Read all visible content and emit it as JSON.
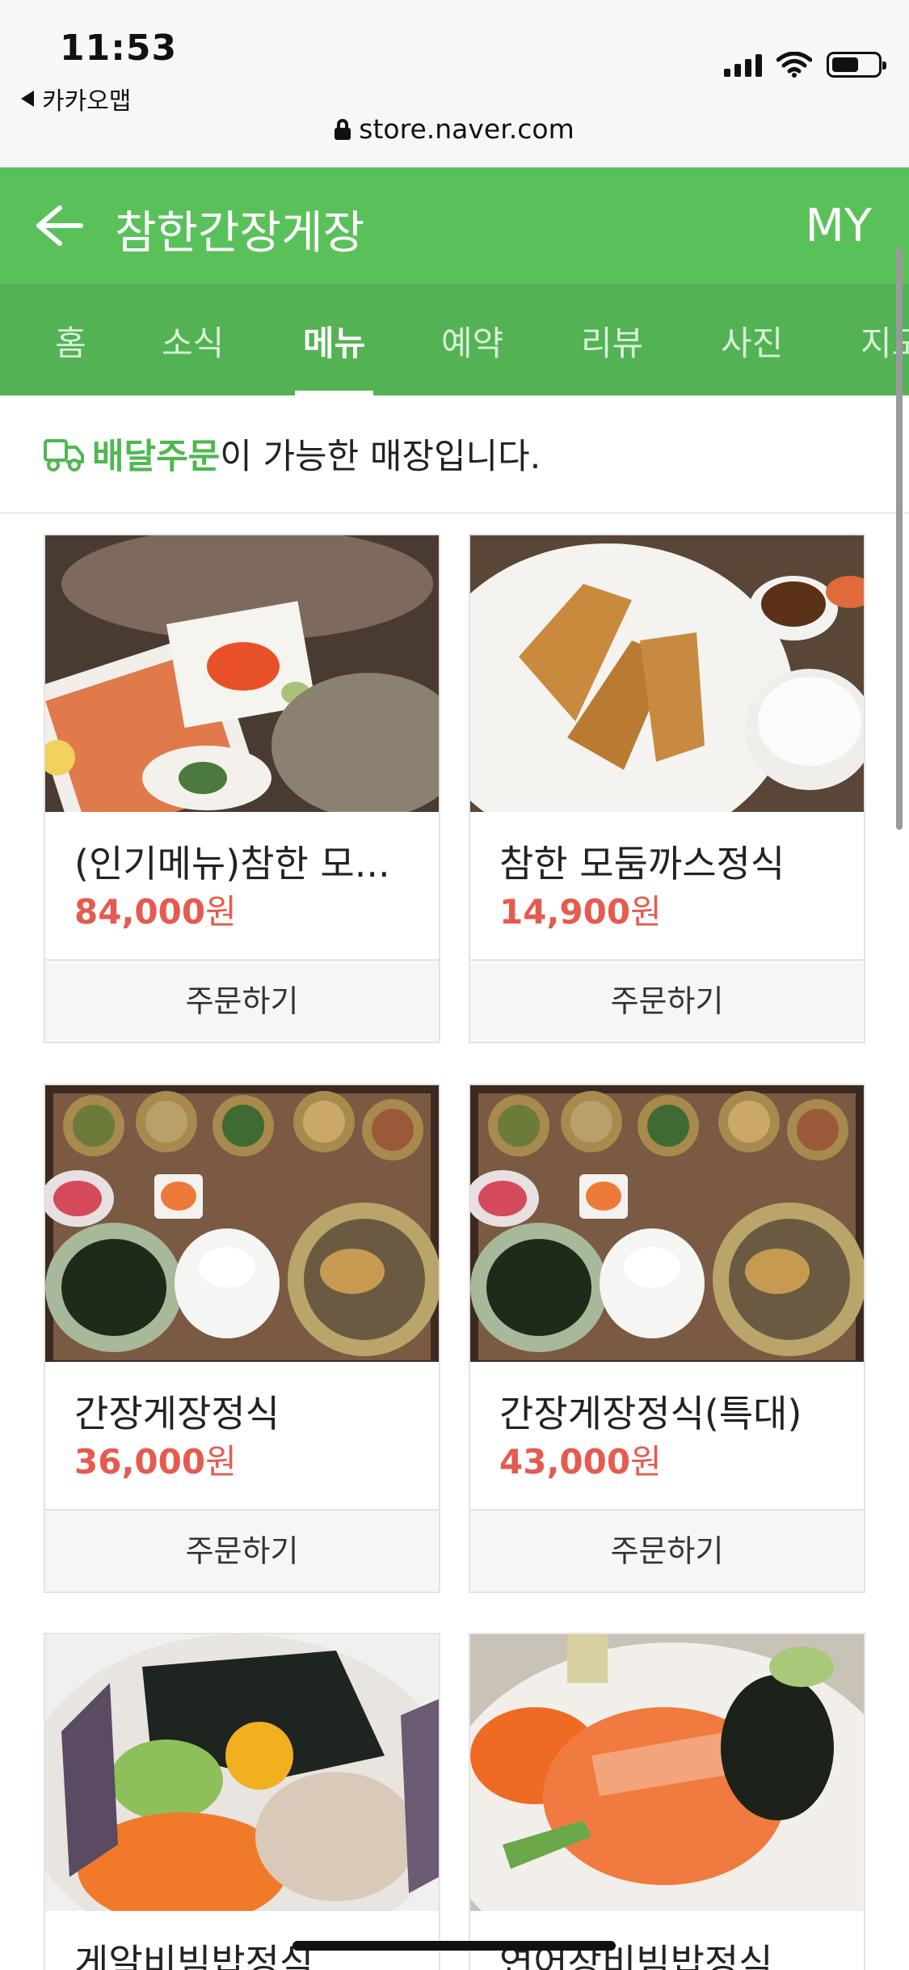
{
  "status_bar": {
    "time": "11:53",
    "back_app": "카카오맵",
    "url": "store.naver.com"
  },
  "header": {
    "title": "참한간장게장",
    "my": "MY"
  },
  "tabs": [
    "홈",
    "소식",
    "메뉴",
    "예약",
    "리뷰",
    "사진",
    "지도"
  ],
  "active_tab": "메뉴",
  "notice": {
    "highlight": "배달주문",
    "text": "이 가능한 매장입니다."
  },
  "menu": [
    {
      "name": "(인기메뉴)참한 모...",
      "price": "84,000",
      "unit": "원",
      "order": "주문하기"
    },
    {
      "name": "참한 모둠까스정식",
      "price": "14,900",
      "unit": "원",
      "order": "주문하기"
    },
    {
      "name": "간장게장정식",
      "price": "36,000",
      "unit": "원",
      "order": "주문하기"
    },
    {
      "name": "간장게장정식(특대)",
      "price": "43,000",
      "unit": "원",
      "order": "주문하기"
    },
    {
      "name": "게알비빔밥정식",
      "price": "",
      "unit": "",
      "order": ""
    },
    {
      "name": "연어장비빔밥정식",
      "price": "",
      "unit": "",
      "order": ""
    }
  ],
  "colors": {
    "header_green": "#5ac15a",
    "tab_green": "#53b253",
    "price_red": "#e55b4f",
    "highlight_green": "#4fb74f"
  }
}
